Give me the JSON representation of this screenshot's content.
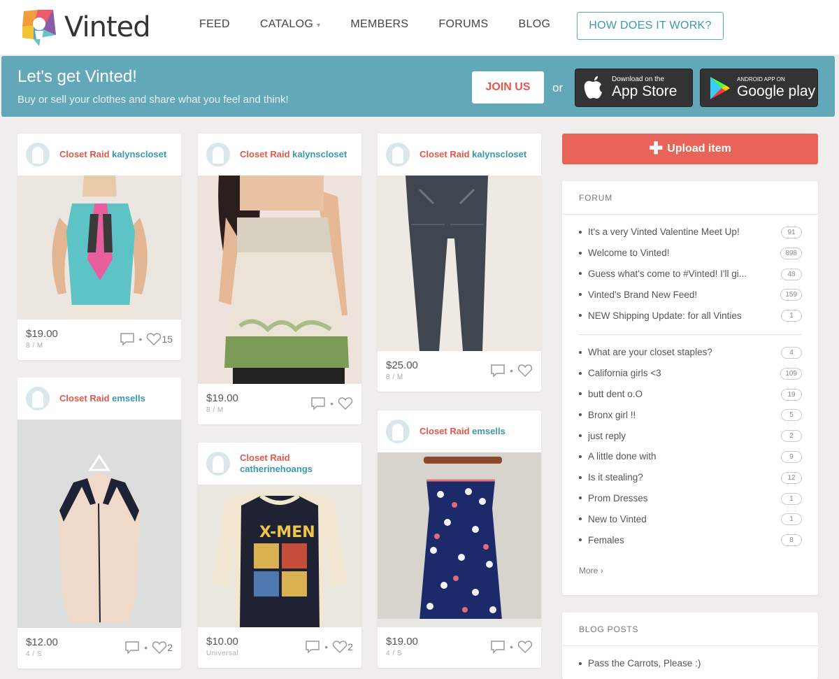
{
  "header": {
    "logo_text": "Vinted",
    "nav": [
      {
        "label": "FEED"
      },
      {
        "label": "CATALOG"
      },
      {
        "label": "MEMBERS"
      },
      {
        "label": "FORUMS"
      },
      {
        "label": "BLOG"
      }
    ],
    "how_button": "HOW DOES IT WORK?"
  },
  "banner": {
    "title": "Let's get Vinted!",
    "subtitle": "Buy or sell your clothes and share what you feel and think!",
    "join_label": "JOIN US",
    "or_label": "or",
    "appstore_small": "Download on the",
    "appstore_big": "App Store",
    "googleplay_small": "ANDROID APP ON",
    "googleplay_big": "Google play"
  },
  "items": [
    {
      "brand": "Closet Raid",
      "user": "kalynscloset",
      "price": "$19.00",
      "size": "8 / M",
      "likes": "15",
      "icon": "sleeveless-top-photo"
    },
    {
      "brand": "Closet Raid",
      "user": "emsells",
      "price": "$12.00",
      "size": "4 / S",
      "likes": "2",
      "icon": "blouse-photo"
    },
    {
      "brand": "Closet Raid",
      "user": "kalynscloset",
      "price": "$19.00",
      "size": "8 / M",
      "likes": "",
      "icon": "camisole-photo"
    },
    {
      "brand": "Closet Raid",
      "user": "catherinehoangs",
      "price": "$10.00",
      "size": "Universal",
      "likes": "2",
      "icon": "xmen-shirt-photo"
    },
    {
      "brand": "Closet Raid",
      "user": "kalynscloset",
      "price": "$25.00",
      "size": "8 / M",
      "likes": "",
      "icon": "jeans-photo"
    },
    {
      "brand": "Closet Raid",
      "user": "emsells",
      "price": "$19.00",
      "size": "4 / S",
      "likes": "",
      "icon": "polka-dress-photo"
    }
  ],
  "sidebar": {
    "upload_label": "Upload item",
    "forum": {
      "title": "FORUM",
      "pinned": [
        {
          "title": "It's a very Vinted Valentine Meet Up!",
          "count": "91"
        },
        {
          "title": "Welcome to Vinted!",
          "count": "898"
        },
        {
          "title": "Guess what's come to #Vinted! I'll gi...",
          "count": "48"
        },
        {
          "title": "Vinted's Brand New Feed!",
          "count": "159"
        },
        {
          "title": "NEW Shipping Update: for all Vinties",
          "count": "1"
        }
      ],
      "topics": [
        {
          "title": "What are your closet staples?",
          "count": "4"
        },
        {
          "title": "California girls <3",
          "count": "109"
        },
        {
          "title": "butt dent o.O",
          "count": "19"
        },
        {
          "title": "Bronx girl !!",
          "count": "5"
        },
        {
          "title": "just reply",
          "count": "2"
        },
        {
          "title": "A little done with",
          "count": "9"
        },
        {
          "title": "Is it stealing?",
          "count": "12"
        },
        {
          "title": "Prom Dresses",
          "count": "1"
        },
        {
          "title": "New to Vinted",
          "count": "1"
        },
        {
          "title": "Females",
          "count": "8"
        }
      ],
      "more_label": "More"
    },
    "blog": {
      "title": "BLOG POSTS",
      "posts": [
        {
          "title": "Pass the Carrots, Please :)"
        }
      ]
    }
  }
}
